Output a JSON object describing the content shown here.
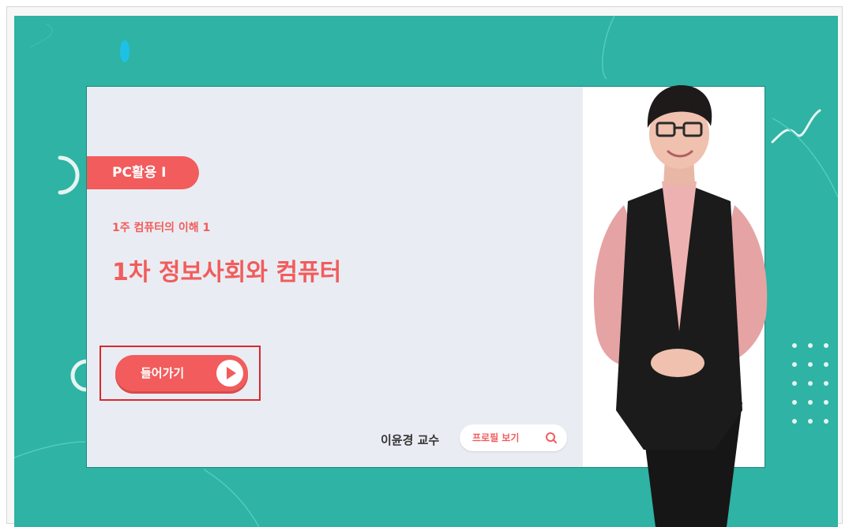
{
  "course": {
    "badge": "PC활용 I",
    "week": "1주 컴퓨터의 이해 1",
    "title": "1차 정보사회와 컴퓨터",
    "enter_label": "들어가기"
  },
  "professor": {
    "name": "이윤경 교수",
    "profile_label": "프로필 보기"
  },
  "colors": {
    "stage": "#2eb3a4",
    "accent": "#f25c5c",
    "card": "#e9edf3"
  },
  "icons": [
    "play-icon",
    "search-icon",
    "dot-grid-icon"
  ]
}
